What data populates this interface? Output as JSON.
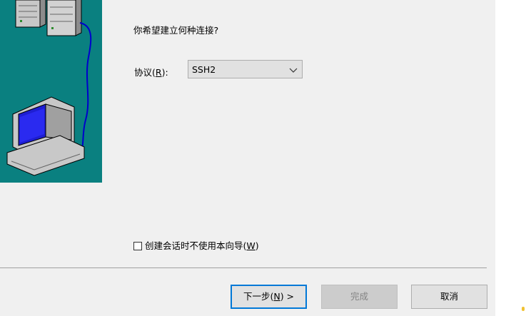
{
  "wizard": {
    "question": "你希望建立何种连接?",
    "protocol_label_prefix": "协议(",
    "protocol_label_mnemonic": "R",
    "protocol_label_suffix": "):",
    "protocol_value": "SSH2",
    "skip_wizard_prefix": "创建会话时不使用本向导(",
    "skip_wizard_mnemonic": "W",
    "skip_wizard_suffix": ")",
    "skip_wizard_checked": false
  },
  "buttons": {
    "next_prefix": "下一步(",
    "next_mnemonic": "N",
    "next_suffix": ") >",
    "finish": "完成",
    "cancel": "取消"
  },
  "illustration": {
    "icon": "network-connection-illustration",
    "background_color": "#0a8080"
  }
}
